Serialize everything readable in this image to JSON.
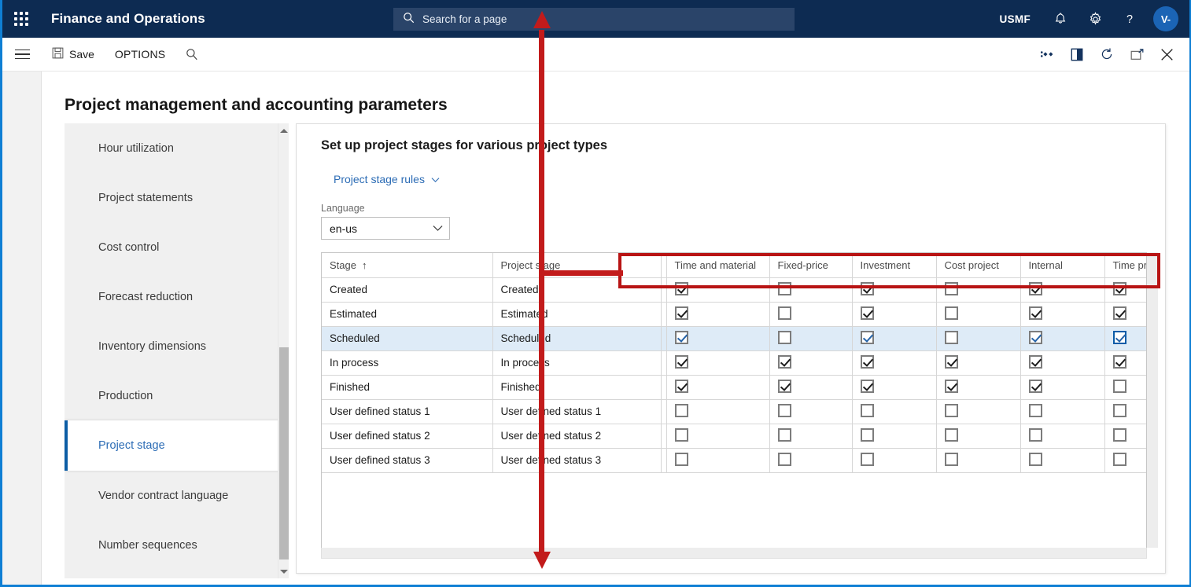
{
  "topbar": {
    "waffle_icon": "app-launcher-icon",
    "app_title": "Finance and Operations",
    "search": {
      "icon": "search-icon",
      "placeholder": "Search for a page",
      "value": ""
    },
    "company": "USMF",
    "icons": [
      {
        "name": "notifications-bell-icon",
        "glyph": "bell"
      },
      {
        "name": "settings-gear-icon",
        "glyph": "gear"
      },
      {
        "name": "help-question-icon",
        "glyph": "?"
      }
    ],
    "avatar_initials": "V-"
  },
  "cmdbar": {
    "menu_icon": "hamburger-menu-icon",
    "save_label": "Save",
    "save_icon": "save-disk-icon",
    "options_label": "OPTIONS",
    "search_icon": "search-icon",
    "right_icons": [
      {
        "name": "attachments-icon"
      },
      {
        "name": "open-in-new-icon"
      },
      {
        "name": "refresh-icon"
      },
      {
        "name": "popout-icon"
      },
      {
        "name": "close-icon"
      }
    ]
  },
  "page": {
    "title": "Project management and accounting parameters"
  },
  "sidebar": {
    "items": [
      {
        "label": "Hour utilization",
        "selected": false
      },
      {
        "label": "Project statements",
        "selected": false
      },
      {
        "label": "Cost control",
        "selected": false
      },
      {
        "label": "Forecast reduction",
        "selected": false
      },
      {
        "label": "Inventory dimensions",
        "selected": false
      },
      {
        "label": "Production",
        "selected": false
      },
      {
        "label": "Project stage",
        "selected": true
      },
      {
        "label": "Vendor contract language",
        "selected": false
      },
      {
        "label": "Number sequences",
        "selected": false
      }
    ]
  },
  "panel": {
    "title": "Set up project stages for various project types",
    "stage_rules_label": "Project stage rules",
    "stage_rules_chevron": "chevron-down-icon",
    "language_label": "Language",
    "language_value": "en-us",
    "language_chevron": "chevron-down-icon"
  },
  "grid": {
    "columns": [
      {
        "key": "stage",
        "label": "Stage",
        "sorted": true,
        "sort_glyph": "↑"
      },
      {
        "key": "project_stage",
        "label": "Project stage"
      },
      {
        "key": "spacer",
        "label": ""
      },
      {
        "key": "time_and_material",
        "label": "Time and material"
      },
      {
        "key": "fixed_price",
        "label": "Fixed-price"
      },
      {
        "key": "investment",
        "label": "Investment"
      },
      {
        "key": "cost_project",
        "label": "Cost project"
      },
      {
        "key": "internal",
        "label": "Internal"
      },
      {
        "key": "time_project",
        "label": "Time project"
      }
    ],
    "rows": [
      {
        "stage": "Created",
        "project_stage": "Created",
        "selected": false,
        "checks": [
          true,
          false,
          true,
          false,
          true,
          true
        ],
        "focused_index": -1
      },
      {
        "stage": "Estimated",
        "project_stage": "Estimated",
        "selected": false,
        "checks": [
          true,
          false,
          true,
          false,
          true,
          true
        ],
        "focused_index": -1
      },
      {
        "stage": "Scheduled",
        "project_stage": "Scheduled",
        "selected": true,
        "checks": [
          true,
          false,
          true,
          false,
          true,
          true
        ],
        "focused_index": 5
      },
      {
        "stage": "In process",
        "project_stage": "In process",
        "selected": false,
        "checks": [
          true,
          true,
          true,
          true,
          true,
          true
        ],
        "focused_index": -1
      },
      {
        "stage": "Finished",
        "project_stage": "Finished",
        "selected": false,
        "checks": [
          true,
          true,
          true,
          true,
          true,
          false
        ],
        "focused_index": -1
      },
      {
        "stage": "User defined status 1",
        "project_stage": "User defined status 1",
        "selected": false,
        "checks": [
          false,
          false,
          false,
          false,
          false,
          false
        ],
        "focused_index": -1
      },
      {
        "stage": "User defined status 2",
        "project_stage": "User defined status 2",
        "selected": false,
        "checks": [
          false,
          false,
          false,
          false,
          false,
          false
        ],
        "focused_index": -1
      },
      {
        "stage": "User defined status 3",
        "project_stage": "User defined status 3",
        "selected": false,
        "checks": [
          false,
          false,
          false,
          false,
          false,
          false
        ],
        "focused_index": -1
      }
    ]
  },
  "annotation": {
    "color": "#c21b1b",
    "box_color": "#b81414",
    "arrow_kind": "double-headed-vertical-arrow",
    "highlight_target": "project-type-column-headers"
  },
  "colors": {
    "nav_bg": "#0d2b52",
    "search_bg": "#2a4469",
    "accent_blue": "#0c5da5",
    "link_blue": "#2c6cb5",
    "row_selected": "#deebf7",
    "page_border": "#0f7fd4"
  }
}
